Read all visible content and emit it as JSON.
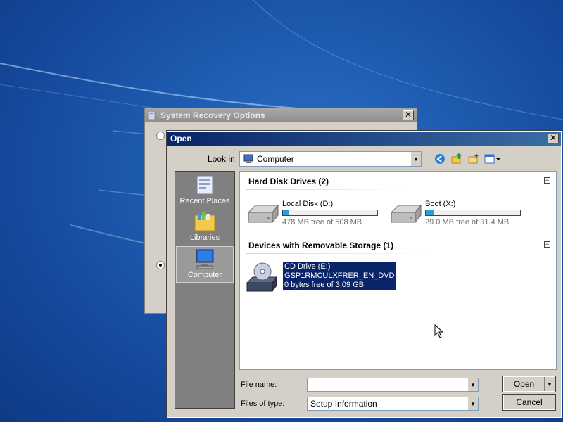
{
  "background_dialog": {
    "title": "System Recovery Options",
    "close_glyph": "✕"
  },
  "open_dialog": {
    "title": "Open",
    "close_glyph": "✕",
    "look_in": {
      "label": "Look in:",
      "value": "Computer"
    },
    "toolbar": [
      {
        "icon": "back-icon"
      },
      {
        "icon": "up-folder-icon"
      },
      {
        "icon": "new-folder-icon"
      },
      {
        "icon": "view-menu-icon"
      }
    ],
    "places": [
      {
        "label": "Recent Places",
        "icon": "recent-places-icon"
      },
      {
        "label": "Libraries",
        "icon": "libraries-icon"
      },
      {
        "label": "Computer",
        "icon": "computer-icon",
        "selected": true
      }
    ],
    "groups": {
      "hdd": {
        "title": "Hard Disk Drives (2)",
        "drives": [
          {
            "name": "Local Disk (D:)",
            "free_text": "478 MB free of 508 MB",
            "used_fraction": 0.06
          },
          {
            "name": "Boot (X:)",
            "free_text": "29.0 MB free of 31.4 MB",
            "used_fraction": 0.08
          }
        ]
      },
      "removable": {
        "title": "Devices with Removable Storage (1)",
        "cd": {
          "name": "CD Drive (E:)",
          "volume": "GSP1RMCULXFRER_EN_DVD",
          "free_text": "0 bytes free of 3.09 GB"
        }
      }
    },
    "file_name": {
      "label": "File name:",
      "value": ""
    },
    "files_of_type": {
      "label": "Files of type:",
      "value": "Setup Information"
    },
    "buttons": {
      "open": "Open",
      "cancel": "Cancel"
    }
  },
  "colors": {
    "selection": "#0a246a",
    "title_active": "#0a246a",
    "desktop": "#1d5cb0"
  }
}
